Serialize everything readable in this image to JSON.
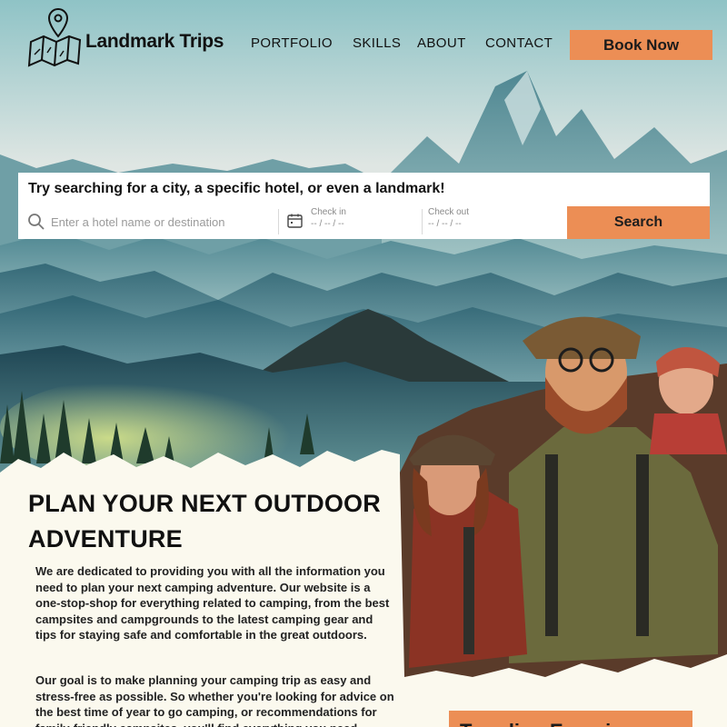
{
  "brand": {
    "name": "Landmark Trips"
  },
  "nav": {
    "items": [
      {
        "label": "PORTFOLIO"
      },
      {
        "label": "SKILLS"
      },
      {
        "label": "ABOUT"
      },
      {
        "label": "CONTACT"
      }
    ],
    "cta_label": "Book Now"
  },
  "search": {
    "prompt": "Try searching for a city, a specific hotel, or even a landmark!",
    "placeholder": "Enter a hotel name or destination",
    "check_in_label": "Check in",
    "check_in_value": "-- / -- / --",
    "check_out_label": "Check out",
    "check_out_value": "-- / -- / --",
    "button_label": "Search"
  },
  "main": {
    "headline": "PLAN YOUR NEXT OUTDOOR ADVENTURE",
    "paragraph1": "We are dedicated to providing you with all the information you need to plan your next camping adventure. Our website is a one-stop-shop for everything related to camping, from the best campsites and campgrounds to the latest camping gear and tips for staying safe and comfortable in the great outdoors.",
    "paragraph2": "Our goal is to make planning your camping trip as easy and stress-free as possible. So whether you're looking for advice on the best time of year to go camping, or recommendations for family-friendly campsites, you'll find everything you need",
    "trending_title": "Trending Experiences"
  },
  "colors": {
    "accent": "#ec8e55",
    "panel": "#ffffff",
    "cream": "#fbf9ee",
    "sky_top": "#9cc5c8",
    "mountain_dark": "#2a4c59"
  }
}
